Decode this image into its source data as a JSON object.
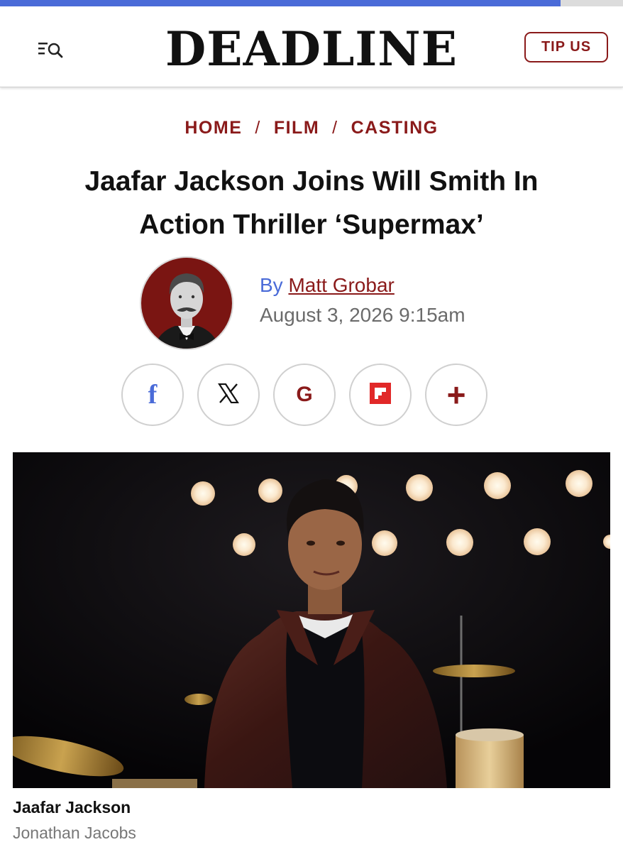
{
  "reading_progress": 0.9,
  "header": {
    "logo": "DEADLINE",
    "menu_icon": "menu-search-icon",
    "tip_label": "TIP US"
  },
  "breadcrumb": {
    "items": [
      "HOME",
      "FILM",
      "CASTING"
    ],
    "separator": "/"
  },
  "article": {
    "headline_line1": "Jaafar Jackson Joins Will Smith In",
    "headline_line2": "Action Thriller ‘Supermax’",
    "by_prefix": "By",
    "author": "Matt Grobar",
    "date": "August 3, 2026 9:15am"
  },
  "share": {
    "icons": [
      "facebook-icon",
      "x-icon",
      "google-icon",
      "flipboard-icon",
      "plus-icon"
    ],
    "facebook_glyph": "f",
    "x_glyph": "𝕏",
    "google_glyph": "G",
    "plus_glyph": "+"
  },
  "photo": {
    "caption": "Jaafar Jackson",
    "credit": "Jonathan Jacobs"
  },
  "colors": {
    "brand_red": "#8a1a1a",
    "link_blue": "#4a6bd8",
    "facebook_blue": "#4a6bd8",
    "flipboard_red": "#e12828"
  }
}
